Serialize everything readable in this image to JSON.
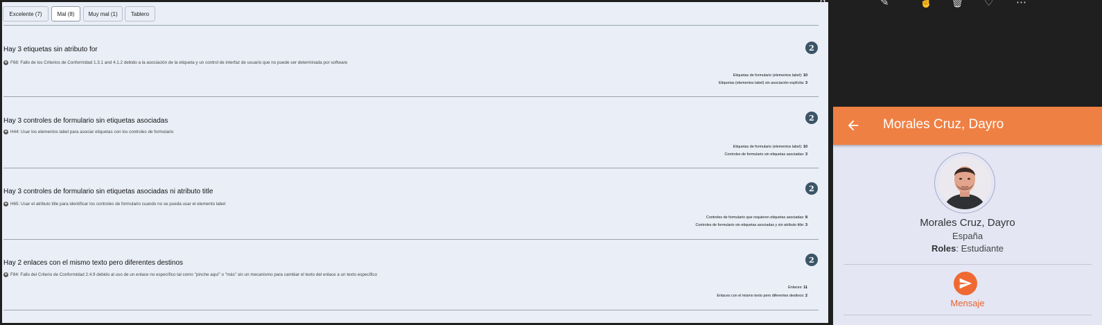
{
  "tabs": [
    {
      "label": "Excelente (7)"
    },
    {
      "label": "Mal (8)"
    },
    {
      "label": "Muy mal (1)"
    },
    {
      "label": "Tablero"
    }
  ],
  "issues": [
    {
      "title": "Hay 3 etiquetas sin atributo for",
      "count": "2",
      "technique": "F68: Fallo de los Criterios de Conformidad 1.3.1 and 4.1.2 debido a la asociación de la etiqueta y un control de interfaz de usuario que no puede ser determinada por software",
      "stats": [
        {
          "label": "Etiquetas de formulario (elementos label):",
          "value": "10"
        },
        {
          "label": "Etiquetas (elementos label) sin asociación explícita:",
          "value": "3"
        }
      ]
    },
    {
      "title": "Hay 3 controles de formulario sin etiquetas asociadas",
      "count": "2",
      "technique": "H44: Usar los elementos label para asociar etiquetas con los controles de formulario",
      "stats": [
        {
          "label": "Etiquetas de formulario (elementos label):",
          "value": "10"
        },
        {
          "label": "Controles de formulario sin etiquetas asociadas:",
          "value": "3"
        }
      ]
    },
    {
      "title": "Hay 3 controles de formulario sin etiquetas asociadas ni atributo title",
      "count": "2",
      "technique": "H65: Usar el atributo title para identificar los controles de formulario cuando no se pueda usar el elemento label",
      "stats": [
        {
          "label": "Controles de formulario que requieren etiquetas asociadas:",
          "value": "8"
        },
        {
          "label": "Controles de formulario sin etiquetas asociadas y sin atributo title:",
          "value": "3"
        }
      ]
    },
    {
      "title": "Hay 2 enlaces con el mismo texto pero diferentes destinos",
      "count": "2",
      "technique": "F84: Fallo del Criterio de Conformidad 2.4.9 debido al uso de un enlace no específico tal como \"pinche aquí\" o \"más\" sin un mecanismo para cambiar el texto del enlace a un texto específico",
      "stats": [
        {
          "label": "Enlaces:",
          "value": "11"
        },
        {
          "label": "Enlaces con el mismo texto pero diferentes destinos:",
          "value": "2"
        }
      ]
    }
  ],
  "profile": {
    "header_title": "Morales Cruz, Dayro",
    "name": "Morales Cruz, Dayro",
    "country": "España",
    "roles_label": "Roles",
    "roles_value": ": Estudiante",
    "message_label": "Mensaje"
  },
  "colors": {
    "accent": "#ef8043",
    "badge": "#3c5566",
    "report_bg": "#e9eef7",
    "profile_bg": "#e4e6f4"
  }
}
